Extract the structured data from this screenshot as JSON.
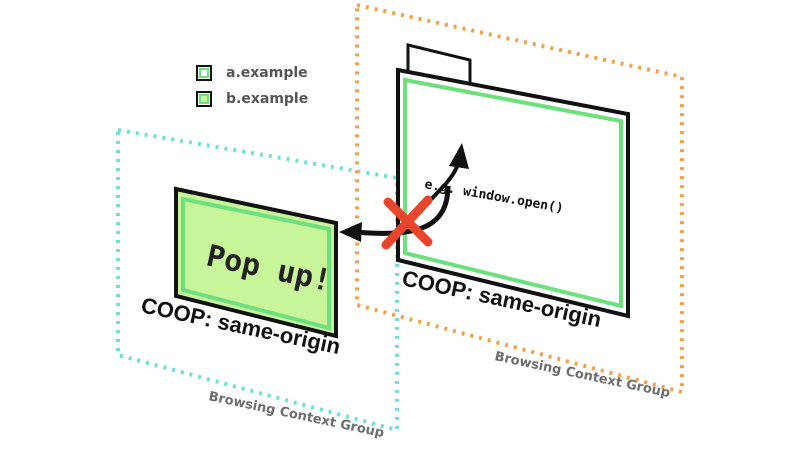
{
  "legend": {
    "items": [
      {
        "label": "a.example",
        "fill": "#ffffff",
        "border": "#6de07e"
      },
      {
        "label": "b.example",
        "fill": "#c8f59a",
        "border": "#6de07e"
      }
    ]
  },
  "popup": {
    "text": "Pop up!",
    "coop_label": "COOP: same-origin",
    "group_label": "Browsing Context Group"
  },
  "opener": {
    "code_label": "e.g. window.open()",
    "coop_label": "COOP: same-origin",
    "group_label": "Browsing Context Group"
  },
  "colors": {
    "teal_group": "#6fe0d6",
    "orange_group": "#f0a24a",
    "window_border": "#111111",
    "origin_green": "#6de07e",
    "popup_fill": "#c8f59a",
    "blocked_x": "#e8452c"
  }
}
